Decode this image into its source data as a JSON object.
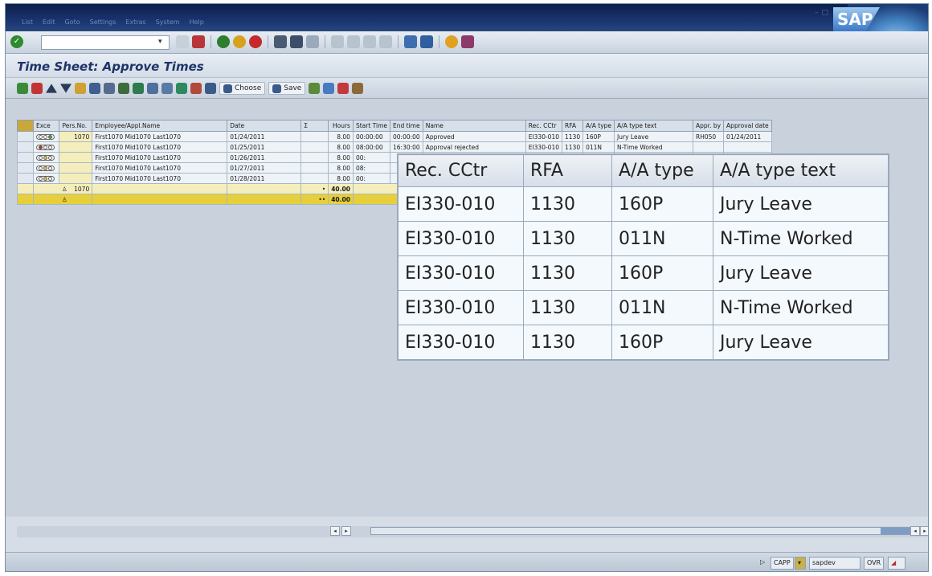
{
  "menu": [
    "List",
    "Edit",
    "Goto",
    "Settings",
    "Extras",
    "System",
    "Help"
  ],
  "brand": "SAP",
  "title": "Time Sheet: Approve Times",
  "app_toolbar": {
    "choose_label": "Choose",
    "save_label": "Save"
  },
  "grid": {
    "headers": [
      "Exce",
      "Pers.No.",
      "Employee/Appl.Name",
      "Date",
      "Σ",
      "Hours",
      "Start Time",
      "End time",
      "Name",
      "Rec. CCtr",
      "RFA",
      "A/A type",
      "A/A type text",
      "Appr. by",
      "Approval date"
    ],
    "rows": [
      {
        "lights": "green",
        "pers_no": "1070",
        "name": "First1070 Mid1070 Last1070",
        "date": "01/24/2011",
        "hours": "8.00",
        "start": "00:00:00",
        "end": "00:00:00",
        "status": "Approved",
        "cctr": "EI330-010",
        "rfa": "1130",
        "aatype": "160P",
        "aatext": "Jury Leave",
        "appr_by": "RH050",
        "appr_date": "01/24/2011"
      },
      {
        "lights": "red",
        "pers_no": "",
        "name": "First1070 Mid1070 Last1070",
        "date": "01/25/2011",
        "hours": "8.00",
        "start": "08:00:00",
        "end": "16:30:00",
        "status": "Approval rejected",
        "cctr": "EI330-010",
        "rfa": "1130",
        "aatype": "011N",
        "aatext": "N-Time Worked",
        "appr_by": "",
        "appr_date": ""
      },
      {
        "lights": "yellow",
        "pers_no": "",
        "name": "First1070 Mid1070 Last1070",
        "date": "01/26/2011",
        "hours": "8.00",
        "start": "00:",
        "end": "",
        "status": "",
        "cctr": "",
        "rfa": "",
        "aatype": "",
        "aatext": "",
        "appr_by": "",
        "appr_date": ""
      },
      {
        "lights": "yellow",
        "pers_no": "",
        "name": "First1070 Mid1070 Last1070",
        "date": "01/27/2011",
        "hours": "8.00",
        "start": "08:",
        "end": "",
        "status": "",
        "cctr": "",
        "rfa": "",
        "aatype": "",
        "aatext": "",
        "appr_by": "",
        "appr_date": ""
      },
      {
        "lights": "yellow",
        "pers_no": "",
        "name": "First1070 Mid1070 Last1070",
        "date": "01/28/2011",
        "hours": "8.00",
        "start": "00:",
        "end": "",
        "status": "",
        "cctr": "",
        "rfa": "",
        "aatype": "",
        "aatext": "",
        "appr_by": "",
        "appr_date": ""
      }
    ],
    "subtotal": {
      "pers_no": "1070",
      "marker": "•",
      "value": "40.00"
    },
    "total": {
      "marker": "••",
      "value": "40.00"
    }
  },
  "zoom_table": {
    "headers": [
      "Rec. CCtr",
      "RFA",
      "A/A type",
      "A/A type text"
    ],
    "rows": [
      [
        "EI330-010",
        "1130",
        "160P",
        "Jury Leave"
      ],
      [
        "EI330-010",
        "1130",
        "011N",
        "N-Time Worked"
      ],
      [
        "EI330-010",
        "1130",
        "160P",
        "Jury Leave"
      ],
      [
        "EI330-010",
        "1130",
        "011N",
        "N-Time Worked"
      ],
      [
        "EI330-010",
        "1130",
        "160P",
        "Jury Leave"
      ]
    ]
  },
  "status": {
    "system": "CAPP",
    "server": "sapdev",
    "mode": "OVR"
  }
}
